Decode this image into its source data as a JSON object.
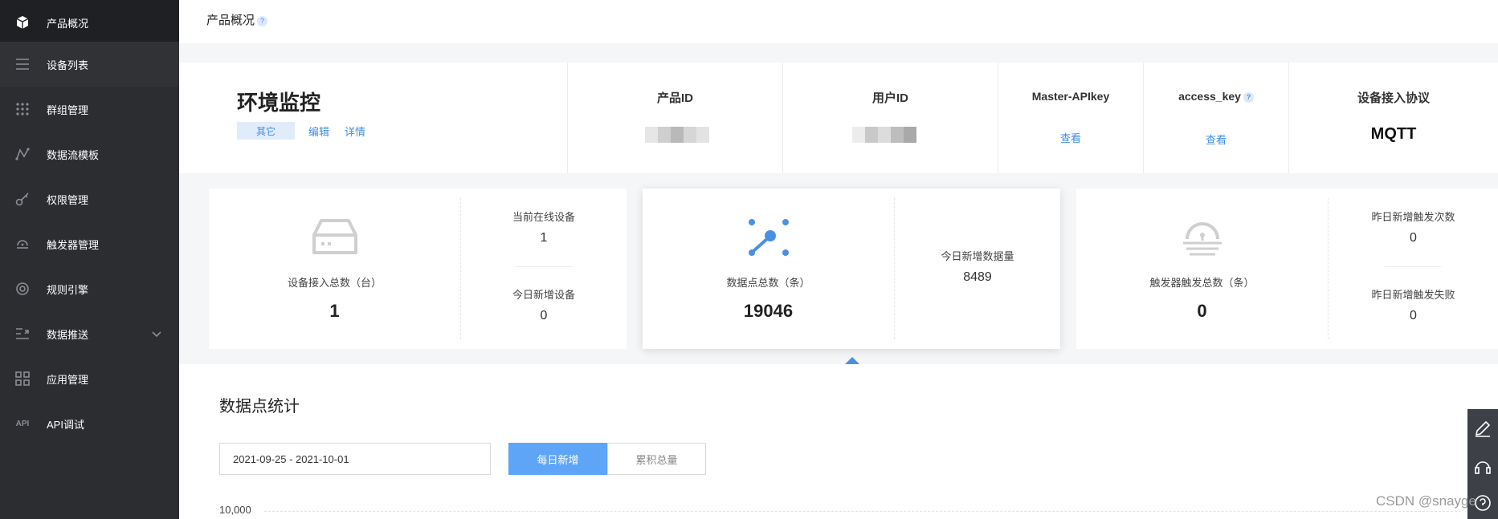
{
  "sidebar": {
    "items": [
      {
        "label": "产品概况",
        "icon": "cube-icon",
        "active": true
      },
      {
        "label": "设备列表",
        "icon": "list-icon"
      },
      {
        "label": "群组管理",
        "icon": "grid-dots-icon"
      },
      {
        "label": "数据流模板",
        "icon": "trend-icon"
      },
      {
        "label": "权限管理",
        "icon": "key-icon"
      },
      {
        "label": "触发器管理",
        "icon": "trigger-icon"
      },
      {
        "label": "规则引擎",
        "icon": "target-icon"
      },
      {
        "label": "数据推送",
        "icon": "push-icon"
      },
      {
        "label": "应用管理",
        "icon": "apps-icon"
      },
      {
        "label": "API调试",
        "icon": "api-icon"
      }
    ]
  },
  "header": {
    "title": "产品概况",
    "help": "?"
  },
  "product": {
    "name": "环境监控",
    "tag": "其它",
    "edit": "编辑",
    "detail": "详情",
    "columns": {
      "product_id": "产品ID",
      "user_id": "用户ID",
      "master_apikey": "Master-APIkey",
      "master_apikey_action": "查看",
      "access_key": "access_key",
      "access_key_action": "查看",
      "protocol_label": "设备接入协议",
      "protocol_value": "MQTT"
    }
  },
  "stats_cards": {
    "devices": {
      "total_label": "设备接入总数（台）",
      "total_value": "1",
      "online_label": "当前在线设备",
      "online_value": "1",
      "new_label": "今日新增设备",
      "new_value": "0"
    },
    "datapoints": {
      "total_label": "数据点总数（条）",
      "total_value": "19046",
      "new_label": "今日新增数据量",
      "new_value": "8489"
    },
    "triggers": {
      "total_label": "触发器触发总数（条）",
      "total_value": "0",
      "yesterday_label": "昨日新增触发次数",
      "yesterday_value": "0",
      "fail_label": "昨日新增触发失败",
      "fail_value": "0"
    }
  },
  "datapoint_stats": {
    "title": "数据点统计",
    "date_range": "2021-09-25 - 2021-10-01",
    "tab_daily": "每日新增",
    "tab_total": "累积总量",
    "y_tick_top": "10,000"
  },
  "watermark": "CSDN @snayge",
  "colors": {
    "accent": "#5ea5f7",
    "sidebar_bg": "#2b2d31"
  }
}
